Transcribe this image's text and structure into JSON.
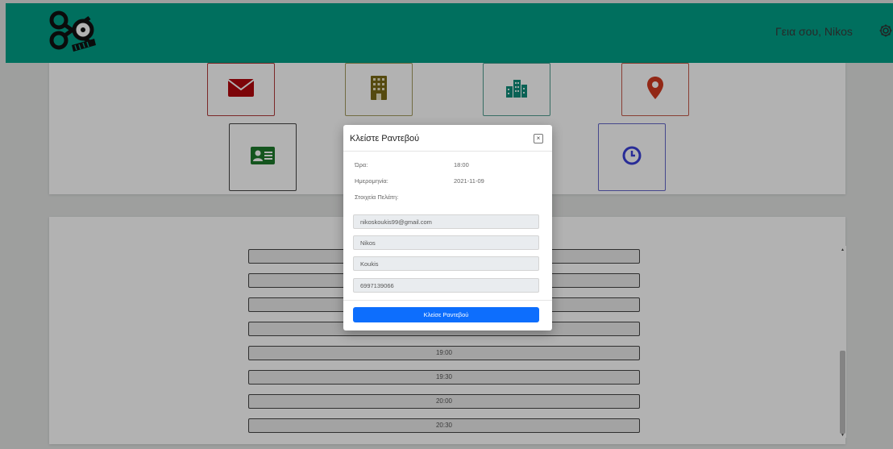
{
  "header": {
    "greeting": "Γεια σου, Nikos",
    "logo_icon": "scissors-comb-logo",
    "settings_icon": "gear-icon",
    "background_color": "#00a087"
  },
  "contact_icons": [
    {
      "name": "envelope-icon",
      "color": "#b3080e"
    },
    {
      "name": "building-icon",
      "color": "#7a6a16"
    },
    {
      "name": "city-buildings-icon",
      "color": "#0f8d7a"
    },
    {
      "name": "map-pin-icon",
      "color": "#d23a20"
    },
    {
      "name": "id-card-icon",
      "color": "#1d7a2b"
    },
    {
      "name": "clock-icon",
      "color": "#3a3fd8"
    }
  ],
  "time_slots": [
    "19:00",
    "19:30",
    "20:00",
    "20:30"
  ],
  "modal": {
    "title": "Κλείστε Ραντεβού",
    "time_label": "Ώρα:",
    "time_value": "18:00",
    "date_label": "Ημερομηνία:",
    "date_value": "2021-11-09",
    "customer_label": "Στοιχεία Πελάτη:",
    "fields": [
      "nikoskoukis99@gmail.com",
      "Nikos",
      "Koukis",
      "6997139066"
    ],
    "submit_label": "Κλείσε Ραντεβού",
    "button_color": "#0d6efd"
  }
}
